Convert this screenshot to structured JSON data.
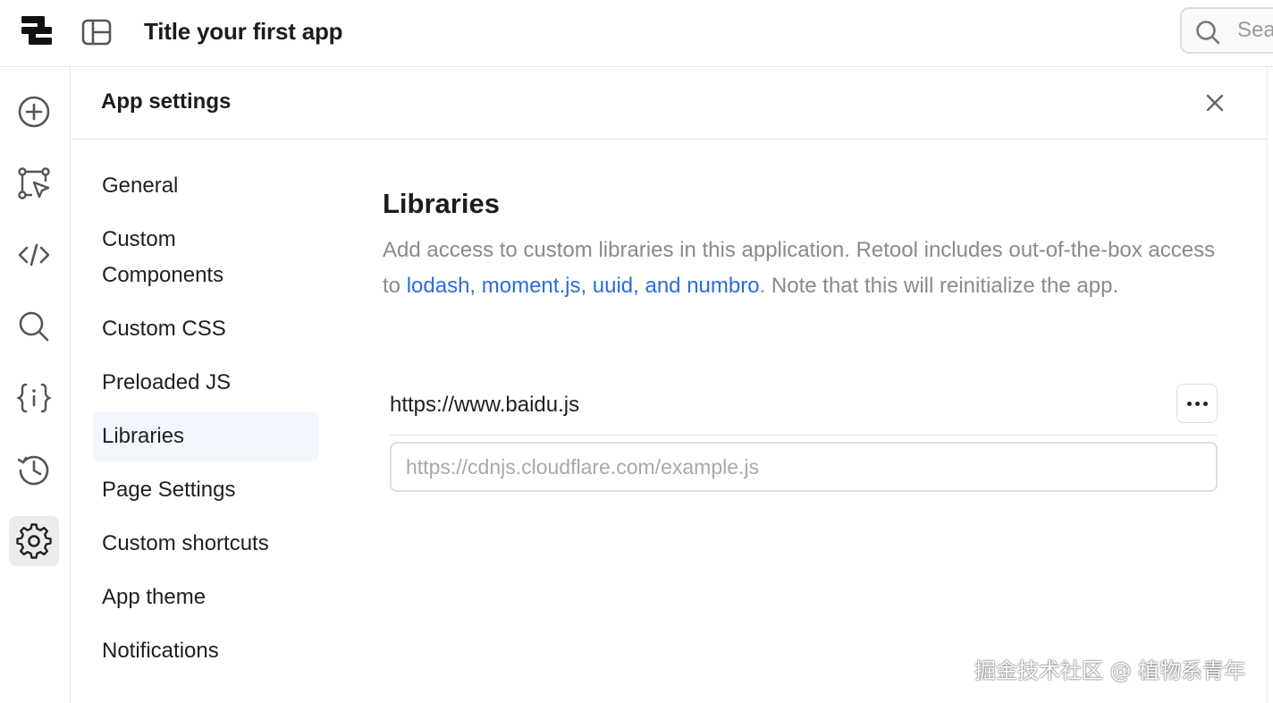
{
  "app": {
    "title": "Title your first app"
  },
  "search": {
    "text": "Sea"
  },
  "rail": {
    "items": [
      {
        "icon": "plus-circle-icon"
      },
      {
        "icon": "component-cursor-icon"
      },
      {
        "icon": "code-icon"
      },
      {
        "icon": "search-icon"
      },
      {
        "icon": "state-braces-icon"
      },
      {
        "icon": "history-icon"
      },
      {
        "icon": "gear-icon",
        "active": true
      }
    ]
  },
  "settings": {
    "title": "App settings",
    "nav": [
      {
        "label": "General"
      },
      {
        "label": "Custom"
      },
      {
        "label": "Components"
      },
      {
        "label": "Custom CSS"
      },
      {
        "label": "Preloaded JS"
      },
      {
        "label": "Libraries",
        "active": true
      },
      {
        "label": "Page Settings"
      },
      {
        "label": "Custom shortcuts"
      },
      {
        "label": "App theme"
      },
      {
        "label": "Notifications"
      }
    ]
  },
  "libraries": {
    "title": "Libraries",
    "desc_before": "Add access to custom libraries in this application. Retool includes out-of-the-box access to ",
    "desc_link": "lodash, moment.js, uuid, and numbro",
    "desc_after": ". Note that this will reinitialize the app.",
    "items": [
      {
        "url": "https://www.baidu.js"
      }
    ],
    "input_placeholder": "https://cdnjs.cloudflare.com/example.js"
  },
  "watermark": {
    "text": "掘金技术社区 @ 植物系青年"
  },
  "colors": {
    "link": "#2a6dd9",
    "muted": "#8a8a8a",
    "active_nav_bg": "#f3f7fd",
    "active_rail_bg": "#ececec"
  }
}
